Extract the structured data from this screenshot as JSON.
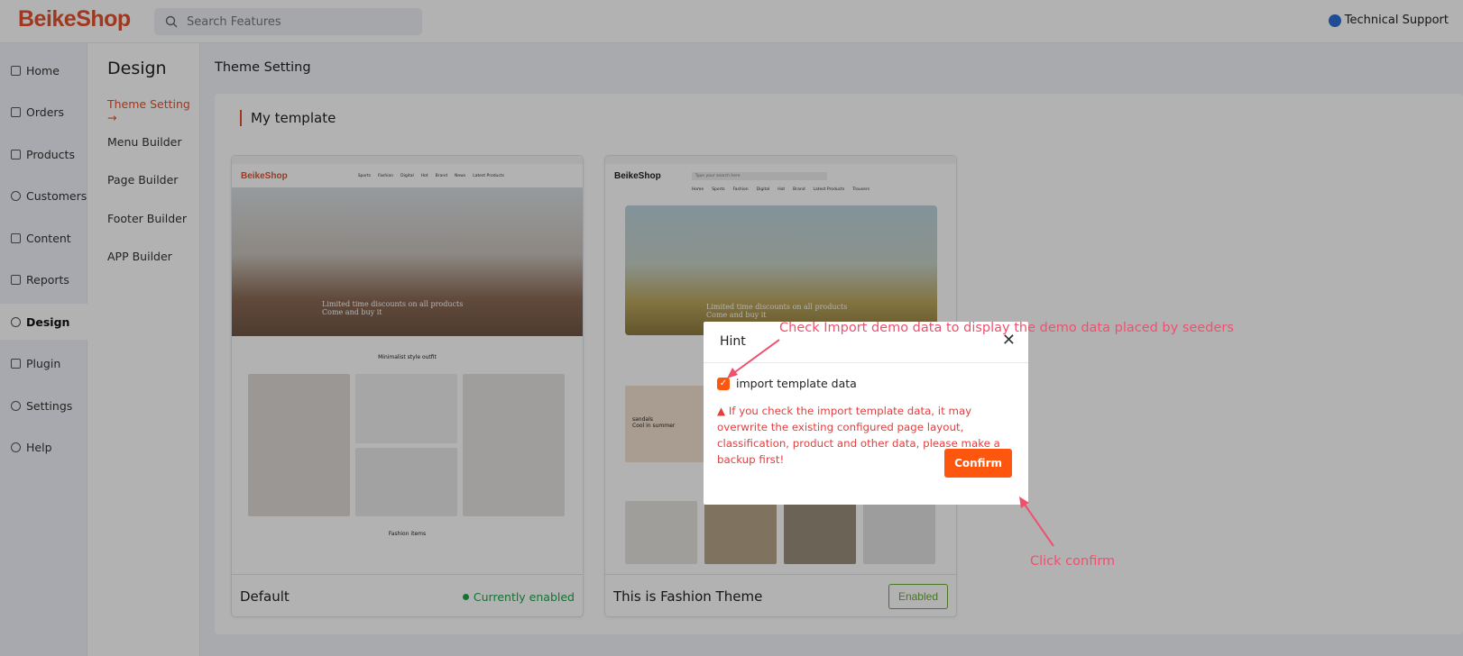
{
  "header": {
    "logo": "BeikeShop",
    "search_placeholder": "Search Features",
    "support": "Technical Support"
  },
  "sidebar": {
    "items": [
      {
        "label": "Home",
        "icon": "home-icon"
      },
      {
        "label": "Orders",
        "icon": "clipboard-icon"
      },
      {
        "label": "Products",
        "icon": "box-icon"
      },
      {
        "label": "Customers",
        "icon": "user-icon"
      },
      {
        "label": "Content",
        "icon": "document-icon"
      },
      {
        "label": "Reports",
        "icon": "chart-icon"
      },
      {
        "label": "Design",
        "icon": "palette-icon",
        "active": true
      },
      {
        "label": "Plugin",
        "icon": "plugin-icon"
      },
      {
        "label": "Settings",
        "icon": "gear-icon"
      },
      {
        "label": "Help",
        "icon": "help-icon"
      }
    ]
  },
  "submenu": {
    "title": "Design",
    "items": [
      {
        "label": "Theme Setting →",
        "active": true
      },
      {
        "label": "Menu Builder"
      },
      {
        "label": "Page Builder"
      },
      {
        "label": "Footer Builder"
      },
      {
        "label": "APP Builder"
      }
    ]
  },
  "main": {
    "title": "Theme Setting",
    "section": "My template",
    "templates": [
      {
        "name": "Default",
        "status": "Currently enabled",
        "preview": {
          "logo": "BeikeShop",
          "nav": [
            "Sports",
            "Fashion",
            "Digital",
            "Hot",
            "Brand",
            "News",
            "Latest Products"
          ],
          "hero_text": "Limited time discounts on all products\nCome and buy it",
          "section_title": "Minimalist style outfit",
          "section2": "Fashion items"
        }
      },
      {
        "name": "This is Fashion Theme",
        "button": "Enabled",
        "preview": {
          "logo": "BeikeShop",
          "search": "Type your search here",
          "nav": [
            "Home",
            "Sports",
            "Fashion",
            "Digital",
            "Hot",
            "Brand",
            "Latest Products",
            "Trousers"
          ],
          "hero_text": "Limited time discounts on all products\nCome and buy it",
          "promo": "sandals\nCool in summer"
        }
      }
    ]
  },
  "dialog": {
    "title": "Hint",
    "checkbox_label": "import template data",
    "checked": true,
    "warning": "If you check the import template data, it may overwrite the existing configured page layout, classification, product and other data, please make a backup first!",
    "confirm": "Confirm"
  },
  "annotations": {
    "checkbox_hint": "Check Import demo data to display the demo data placed by seeders",
    "confirm_hint": "Click confirm"
  },
  "colors": {
    "brand": "#e4512b",
    "confirm": "#fd560f",
    "annotation": "#f0506e",
    "enabled": "#1ea54a"
  }
}
